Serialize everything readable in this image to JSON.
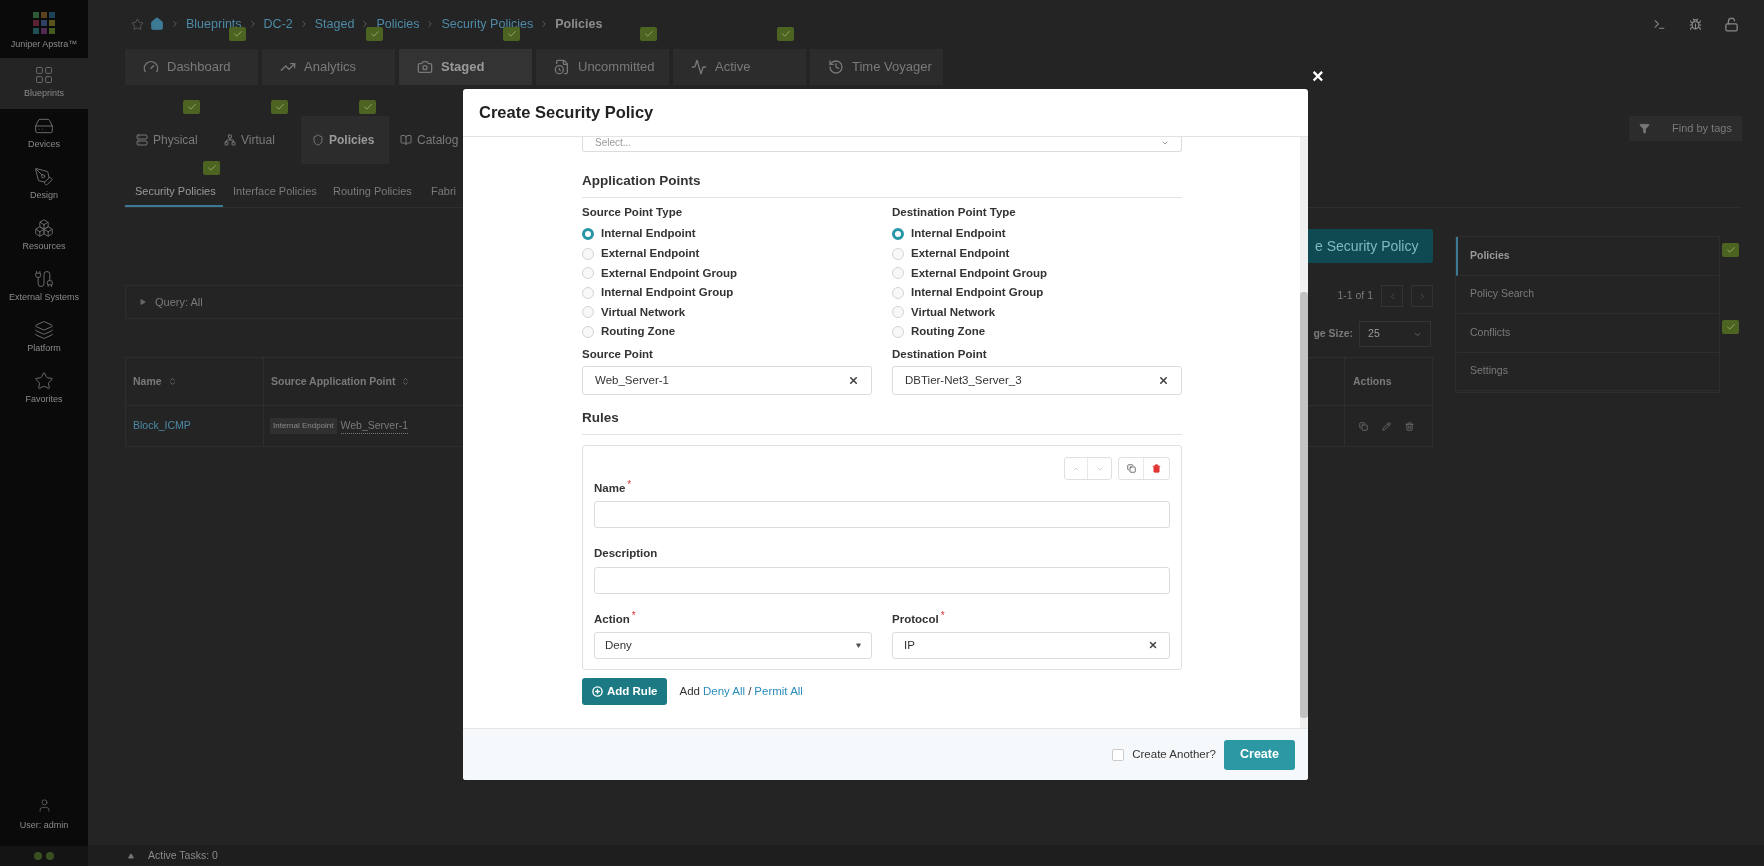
{
  "sidebar": {
    "brand": "Juniper Apstra™",
    "items": [
      {
        "label": "Blueprints",
        "selected": true
      },
      {
        "label": "Devices",
        "selected": false
      },
      {
        "label": "Design",
        "selected": false
      },
      {
        "label": "Resources",
        "selected": false
      },
      {
        "label": "External Systems",
        "selected": false
      },
      {
        "label": "Platform",
        "selected": false
      },
      {
        "label": "Favorites",
        "selected": false
      }
    ],
    "user": "User: admin"
  },
  "breadcrumb": [
    "Blueprints",
    "DC-2",
    "Staged",
    "Policies",
    "Security Policies",
    "Policies"
  ],
  "main_tabs": [
    {
      "label": "Dashboard",
      "selected": false,
      "badge": true
    },
    {
      "label": "Analytics",
      "selected": false,
      "badge": true
    },
    {
      "label": "Staged",
      "selected": true,
      "badge": true
    },
    {
      "label": "Uncommitted",
      "selected": false,
      "badge": true
    },
    {
      "label": "Active",
      "selected": false,
      "badge": true
    },
    {
      "label": "Time Voyager",
      "selected": false,
      "badge": false
    }
  ],
  "sub_tabs": [
    {
      "label": "Physical",
      "selected": false,
      "badge": true
    },
    {
      "label": "Virtual",
      "selected": false,
      "badge": true
    },
    {
      "label": "Policies",
      "selected": true,
      "badge": true
    },
    {
      "label": "Catalog",
      "selected": false
    }
  ],
  "find_by_tags": "Find by tags",
  "policy_tabs": [
    {
      "label": "Security Policies",
      "selected": true,
      "badge": true
    },
    {
      "label": "Interface Policies",
      "selected": false,
      "badge": false
    },
    {
      "label": "Routing Policies",
      "selected": false,
      "badge": false
    },
    {
      "label": "Fabri",
      "selected": false
    }
  ],
  "create_button": "e Security Policy",
  "query": "Query: All",
  "pagination": "1-1 of 1",
  "page_size": {
    "label": "ge Size:",
    "value": "25"
  },
  "table": {
    "columns": [
      "Name",
      "Source Application Point"
    ],
    "actions_column": "Actions",
    "rows": [
      {
        "name": "Block_ICMP",
        "source_type": "Internal Endpoint",
        "source": "Web_Server-1"
      }
    ]
  },
  "right_menu": [
    {
      "label": "Policies",
      "selected": true,
      "badge": true
    },
    {
      "label": "Policy Search",
      "selected": false,
      "badge": false
    },
    {
      "label": "Conflicts",
      "selected": false,
      "badge": true
    },
    {
      "label": "Settings",
      "selected": false,
      "badge": false
    }
  ],
  "status_bar": {
    "active_tasks": "Active Tasks: 0"
  },
  "modal": {
    "title": "Create Security Policy",
    "close": "×",
    "select_placeholder": "Select...",
    "section": "Application Points",
    "source": {
      "label": "Source Point Type",
      "options": [
        {
          "label": "Internal Endpoint",
          "selected": true
        },
        {
          "label": "External Endpoint",
          "selected": false
        },
        {
          "label": "External Endpoint Group",
          "selected": false
        },
        {
          "label": "Internal Endpoint Group",
          "selected": false
        },
        {
          "label": "Virtual Network",
          "selected": false
        },
        {
          "label": "Routing Zone",
          "selected": false
        }
      ],
      "point_label": "Source Point",
      "point_value": "Web_Server-1"
    },
    "destination": {
      "label": "Destination Point Type",
      "options": [
        {
          "label": "Internal Endpoint",
          "selected": true
        },
        {
          "label": "External Endpoint",
          "selected": false
        },
        {
          "label": "External Endpoint Group",
          "selected": false
        },
        {
          "label": "Internal Endpoint Group",
          "selected": false
        },
        {
          "label": "Virtual Network",
          "selected": false
        },
        {
          "label": "Routing Zone",
          "selected": false
        }
      ],
      "point_label": "Destination Point",
      "point_value": "DBTier-Net3_Server_3"
    },
    "rules_title": "Rules",
    "rule": {
      "name": {
        "label": "Name",
        "mark": "*"
      },
      "description": {
        "label": "Description"
      },
      "action": {
        "label": "Action",
        "mark": "*",
        "value": "Deny"
      },
      "protocol": {
        "label": "Protocol",
        "mark": "*",
        "value": "IP"
      }
    },
    "add_rule": "Add Rule",
    "add_text": "Add",
    "deny_all": "Deny All",
    "separator": "/",
    "permit_all": "Permit All",
    "create_another": {
      "label": "Create Another?",
      "checked": false
    },
    "create": "Create"
  }
}
